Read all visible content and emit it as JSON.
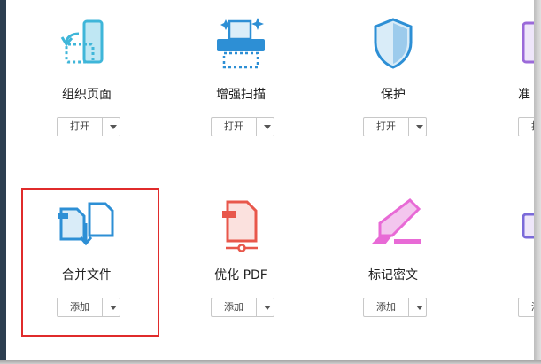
{
  "tools": [
    {
      "id": "organize",
      "label": "组织页面",
      "button": "打开"
    },
    {
      "id": "scan",
      "label": "增强扫描",
      "button": "打开"
    },
    {
      "id": "protect",
      "label": "保护",
      "button": "打开"
    },
    {
      "id": "prepare",
      "label": "准",
      "button": "打开"
    },
    {
      "id": "combine",
      "label": "合并文件",
      "button": "添加"
    },
    {
      "id": "optimize",
      "label": "优化 PDF",
      "button": "添加"
    },
    {
      "id": "redact",
      "label": "标记密文",
      "button": "添加"
    },
    {
      "id": "partial",
      "label": "",
      "button": "添加"
    }
  ],
  "colors": {
    "highlight": "#e02b2b",
    "accent_blue": "#4aa3df",
    "accent_red": "#e8574b",
    "accent_pink": "#e86ad6"
  }
}
